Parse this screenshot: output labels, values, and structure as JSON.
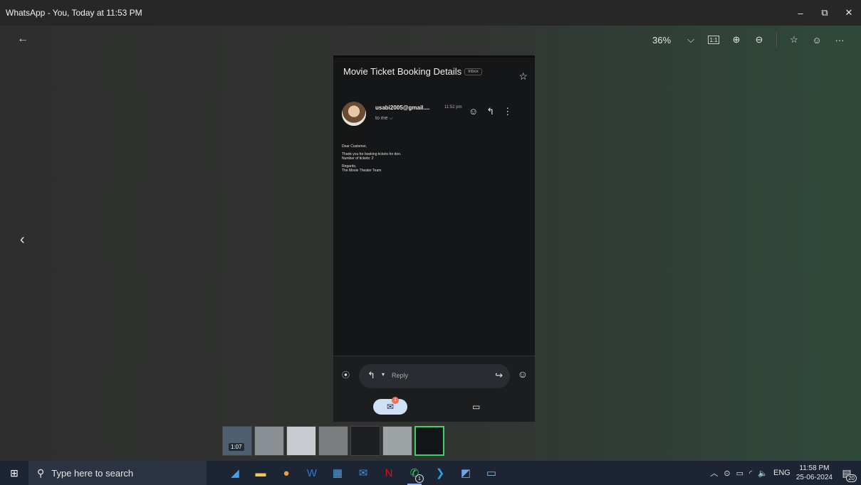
{
  "window": {
    "title": "WhatsApp - You, Today at 11:53 PM",
    "controls": {
      "minimize": "–",
      "restore": "⧉",
      "close": "✕"
    }
  },
  "viewer": {
    "back_icon": "←",
    "prev_icon": "‹",
    "zoom_level": "36%",
    "zoom_caret": "⌵",
    "actual_size_icon": "1:1",
    "zoom_in_icon": "⊕",
    "zoom_out_icon": "⊖",
    "star_icon": "☆",
    "emoji_icon": "☺",
    "more_icon": "···"
  },
  "email": {
    "subject": "Movie Ticket Booking Details",
    "label_chip": "Inbox",
    "star_icon": "☆",
    "sender": "usabi2005@gmail....",
    "time": "11:52 pm",
    "recipient": "to me ⌵",
    "emoji_icon": "☺",
    "reply_icon": "↰",
    "more_icon": "⋮",
    "body": {
      "greeting": "Dear Customer,",
      "line1": "Thank you for booking tickets for don.",
      "line2": "Number of tickets: 2",
      "closing": "Regards,",
      "signature": "The Movie Theater Team"
    },
    "compose": {
      "attach_icon": "⦿",
      "reply_arrow": "↰",
      "caret": "▾",
      "reply_label": "Reply",
      "forward_icon": "↪",
      "emoji_icon": "☺"
    },
    "tabs": {
      "mail_icon": "✉",
      "mail_badge": "1",
      "meet_icon": "▭"
    }
  },
  "filmstrip": {
    "video_duration": "1:07"
  },
  "taskbar": {
    "start_icon": "⊞",
    "search_icon": "⚲",
    "search_placeholder": "Type here to search",
    "apps": [
      {
        "name": "app-1",
        "icon": "◢",
        "color": "#4aa0e6"
      },
      {
        "name": "file-explorer",
        "icon": "▬",
        "color": "#f4c84a"
      },
      {
        "name": "chrome",
        "icon": "●",
        "color": "#e8a33d"
      },
      {
        "name": "word",
        "icon": "W",
        "color": "#2b79d6"
      },
      {
        "name": "store",
        "icon": "▦",
        "color": "#4da3e8"
      },
      {
        "name": "mail",
        "icon": "✉",
        "color": "#3d8fe0"
      },
      {
        "name": "netflix",
        "icon": "N",
        "color": "#e50914"
      },
      {
        "name": "whatsapp",
        "icon": "✆",
        "color": "#25d366",
        "badge": "1"
      },
      {
        "name": "vscode",
        "icon": "❯",
        "color": "#2c9ae8"
      },
      {
        "name": "snipping-tool",
        "icon": "◩",
        "color": "#6ba6e8"
      },
      {
        "name": "mysql",
        "icon": "▭",
        "color": "#8fb9e0"
      }
    ],
    "tray": {
      "chevron": "︿",
      "meet_now": "⊙",
      "battery": "▭",
      "wifi": "◜",
      "volume": "🔈",
      "language": "ENG",
      "time": "11:58 PM",
      "date": "25-06-2024",
      "notif_icon": "▤",
      "notif_count": "20"
    }
  }
}
